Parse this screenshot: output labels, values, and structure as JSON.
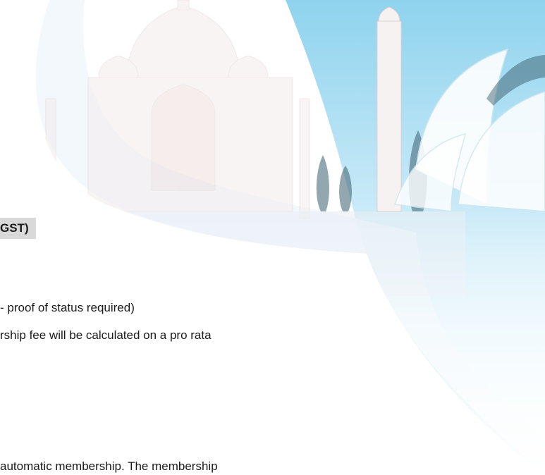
{
  "document": {
    "heading": "GST)",
    "lines": [
      "- proof of status required)",
      "rship fee will be calculated on a pro rata",
      "automatic membership.  The membership"
    ]
  },
  "colors": {
    "heading_highlight": "#d9d9d9",
    "sky_top": "#8fd3ee",
    "sky_light": "#d8f0fa",
    "page_background": "#ffffff"
  }
}
